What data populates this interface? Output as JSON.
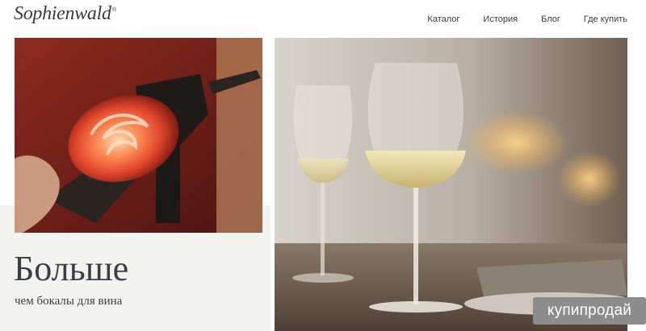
{
  "brand": {
    "logo_text": "Sophienwald",
    "registered": "®"
  },
  "nav": {
    "items": [
      "Каталог",
      "История",
      "Блог",
      "Где купить"
    ]
  },
  "hero": {
    "title": "Больше",
    "subtitle": "чем бокалы для вина"
  },
  "watermark": {
    "text": "купипродай"
  },
  "colors": {
    "panel": "#f2f2ee",
    "text": "#3b3f45",
    "badge": "#8c8c8c"
  }
}
